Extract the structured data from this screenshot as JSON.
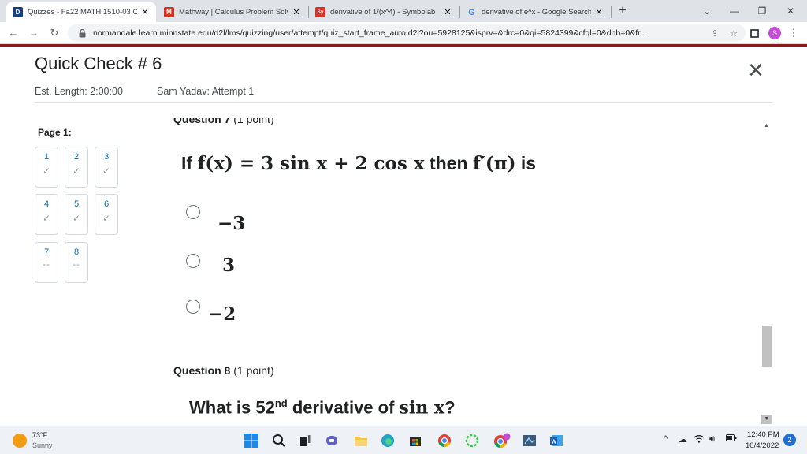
{
  "browser": {
    "tabs": [
      {
        "title": "Quizzes - Fa22 MATH 1510-03 Ca",
        "favicon": "D",
        "favicon_color": "#1a3f7a",
        "active": true
      },
      {
        "title": "Mathway | Calculus Problem Solv",
        "favicon": "M",
        "favicon_color": "#d93025",
        "active": false
      },
      {
        "title": "derivative of 1/(x^4) - Symbolab",
        "favicon": "Sy",
        "favicon_color": "#d93025",
        "active": false
      },
      {
        "title": "derivative of e^x - Google Search",
        "favicon": "G",
        "favicon_color": "#4285f4",
        "active": false
      }
    ],
    "url": "normandale.learn.minnstate.edu/d2l/lms/quizzing/user/attempt/quiz_start_frame_auto.d2l?ou=5928125&isprv=&drc=0&qi=5824399&cfql=0&dnb=0&fr...",
    "profile_initial": "S"
  },
  "quiz": {
    "title": "Quick Check # 6",
    "est_length": "Est. Length: 2:00:00",
    "attempt": "Sam Yadav: Attempt 1",
    "page_label": "Page 1:",
    "tiles": [
      {
        "num": "1",
        "status": "✓"
      },
      {
        "num": "2",
        "status": "✓"
      },
      {
        "num": "3",
        "status": "✓"
      },
      {
        "num": "4",
        "status": "✓"
      },
      {
        "num": "5",
        "status": "✓"
      },
      {
        "num": "6",
        "status": "✓"
      },
      {
        "num": "7",
        "status": "--"
      },
      {
        "num": "8",
        "status": "--"
      }
    ]
  },
  "questions": {
    "q7": {
      "label": "Question 7",
      "points": "(1 point)",
      "prefix": "If ",
      "lhs": "f(x) = 3 sin x + 2 cos x",
      "middle": " then ",
      "rhs": "f′(π)",
      "suffix": " is",
      "choices": [
        "−3",
        "3",
        "−2"
      ]
    },
    "q8": {
      "label": "Question 8",
      "points": "(1 point)",
      "text_a": "What is 52",
      "sup": "nd",
      "text_b": " derivative of ",
      "math": "sin x",
      "text_c": "?"
    }
  },
  "taskbar": {
    "temperature": "73°F",
    "condition": "Sunny",
    "time": "12:40 PM",
    "date": "10/4/2022",
    "notifications": "2"
  }
}
